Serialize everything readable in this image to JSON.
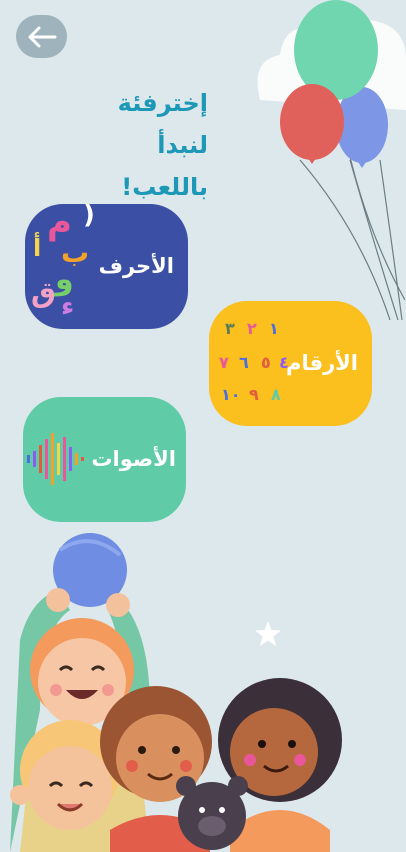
{
  "header": {
    "back_icon": "arrow-left-icon",
    "title_line1": "إخترفئة لنبدأ",
    "title_line2": "باللعب!"
  },
  "categories": [
    {
      "label": "الأحرف",
      "color": "#3b4fa5",
      "glyphs": [
        "م",
        "ب",
        "أ",
        "و",
        "ق",
        "ء"
      ]
    },
    {
      "label": "الأرقام",
      "color": "#fbbf1e",
      "glyphs": [
        "١",
        "٢",
        "٣",
        "٤",
        "٥",
        "٦",
        "٧",
        "٨",
        "٩",
        "١٠"
      ]
    },
    {
      "label": "الأصوات",
      "color": "#5fcba7",
      "icon": "sound-wave-icon"
    }
  ],
  "decorations": [
    "balloons",
    "star",
    "children-illustration"
  ]
}
